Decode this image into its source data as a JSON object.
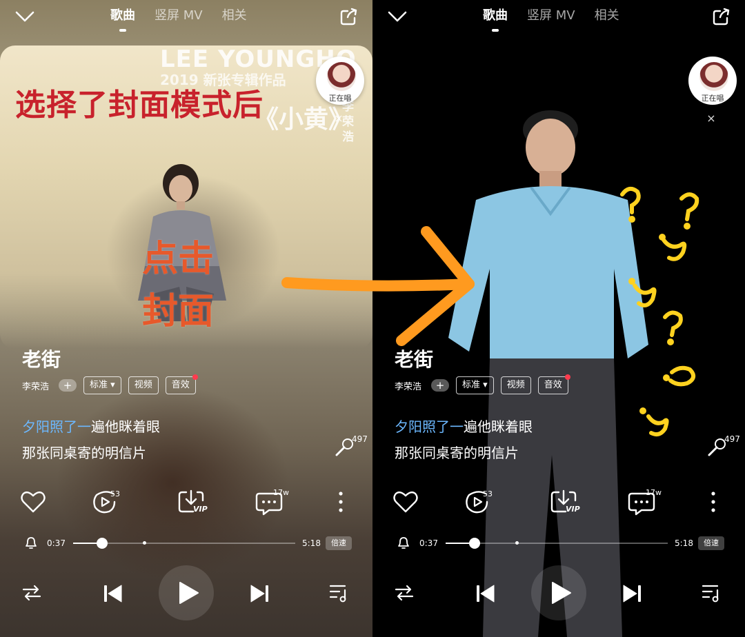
{
  "tabs": [
    {
      "label": "歌曲",
      "active": true
    },
    {
      "label": "竖屏 MV",
      "active": false
    },
    {
      "label": "相关",
      "active": false
    }
  ],
  "album_cover": {
    "title_en": "LEE YOUNGHO",
    "subtitle": "2019 新张专辑作品",
    "title_cn": "《小黄》",
    "artist_vertical": "李荣浩"
  },
  "annotations": {
    "cover_mode": "选择了封面模式后",
    "click_cover": "点击封面"
  },
  "now_playing": {
    "label": "正在唱"
  },
  "song": {
    "title": "老街",
    "artist": "李荣浩",
    "add_label": "+",
    "quality_label": "标准",
    "video_label": "视频",
    "effect_label": "音效"
  },
  "lyrics": {
    "line1_sung": "夕阳照了一",
    "line1_rest": "遍他眯着眼",
    "line2": "那张同桌寄的明信片"
  },
  "counts": {
    "karaoke": "497",
    "plays": "53",
    "comments": "17w"
  },
  "download": {
    "badge": "VIP"
  },
  "playback": {
    "current_time": "0:37",
    "total_time": "5:18",
    "progress": 0.13,
    "marker": 0.32,
    "speed_label": "倍速"
  },
  "colors": {
    "lyric_highlight": "#6cb8ff",
    "annotation_red": "#c8222c",
    "annotation_orange": "#e7592b",
    "arrow_orange": "#ff9a1f",
    "question_yellow": "#ffd21f",
    "notification_dot": "#ff3b4e"
  },
  "icons": [
    "chevron-down-icon",
    "share-icon",
    "heart-icon",
    "play-count-icon",
    "download-icon",
    "comment-icon",
    "more-icon",
    "bell-icon",
    "mic-icon",
    "shuffle-icon",
    "previous-icon",
    "play-icon",
    "next-icon",
    "playlist-icon"
  ]
}
